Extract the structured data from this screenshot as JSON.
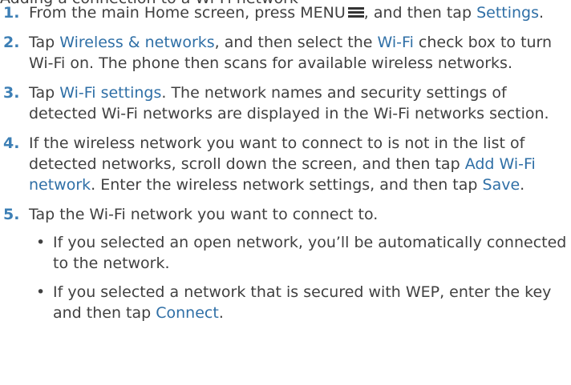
{
  "section_heading_partial": "Adding a connection to a Wi-Fi network",
  "steps": [
    {
      "number": "1.",
      "t1": "From the main Home screen, press MENU",
      "t2": ", and then tap ",
      "k1": "Settings",
      "t3": "."
    },
    {
      "number": "2.",
      "t1": "Tap ",
      "k1": "Wireless & networks",
      "t2": ", and then select the ",
      "k2": "Wi-Fi",
      "t3": " check box to turn Wi-Fi on. The phone then scans for available wireless networks."
    },
    {
      "number": "3.",
      "t1": "Tap ",
      "k1": "Wi-Fi settings",
      "t2": ". The network names and security settings of detected Wi-Fi networks are displayed in the Wi-Fi networks section."
    },
    {
      "number": "4.",
      "t1": "If the wireless network you want to connect to is not in the list of detected networks, scroll down the screen, and then tap ",
      "k1": "Add Wi-Fi network",
      "t2": ". Enter the wireless network settings, and then tap ",
      "k2": "Save",
      "t3": "."
    },
    {
      "number": "5.",
      "t1": "Tap the Wi-Fi network you want to connect to.",
      "bullets": [
        {
          "marker": "•",
          "t1": "If you selected an open network, you’ll be automatically connected to the network."
        },
        {
          "marker": "•",
          "t1": "If you selected a network that is secured with WEP, enter the key and then tap ",
          "k1": "Connect",
          "t2": "."
        }
      ]
    }
  ],
  "icons": {
    "menu": "menu-icon"
  },
  "colors": {
    "text": "#404040",
    "keyword": "#2f6fa6",
    "step_number": "#3d7fb5"
  }
}
